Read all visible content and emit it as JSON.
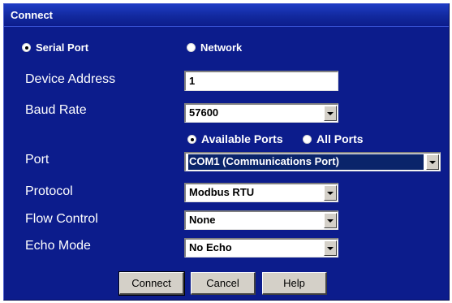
{
  "window": {
    "title": "Connect"
  },
  "connection_type": {
    "serial_label": "Serial Port",
    "network_label": "Network",
    "selected": "serial"
  },
  "fields": {
    "device_address": {
      "label": "Device Address",
      "value": "1"
    },
    "baud_rate": {
      "label": "Baud Rate",
      "value": "57600"
    },
    "port_filter": {
      "available_label": "Available Ports",
      "all_label": "All Ports",
      "selected": "available"
    },
    "port": {
      "label": "Port",
      "value": "COM1 (Communications Port)"
    },
    "protocol": {
      "label": "Protocol",
      "value": "Modbus RTU"
    },
    "flow_control": {
      "label": "Flow Control",
      "value": "None"
    },
    "echo_mode": {
      "label": "Echo Mode",
      "value": "No Echo"
    }
  },
  "buttons": {
    "connect": "Connect",
    "cancel": "Cancel",
    "help": "Help"
  },
  "colors": {
    "background": "#0c1c8c",
    "title_bar": "#12299e",
    "selection": "#0a246a"
  }
}
